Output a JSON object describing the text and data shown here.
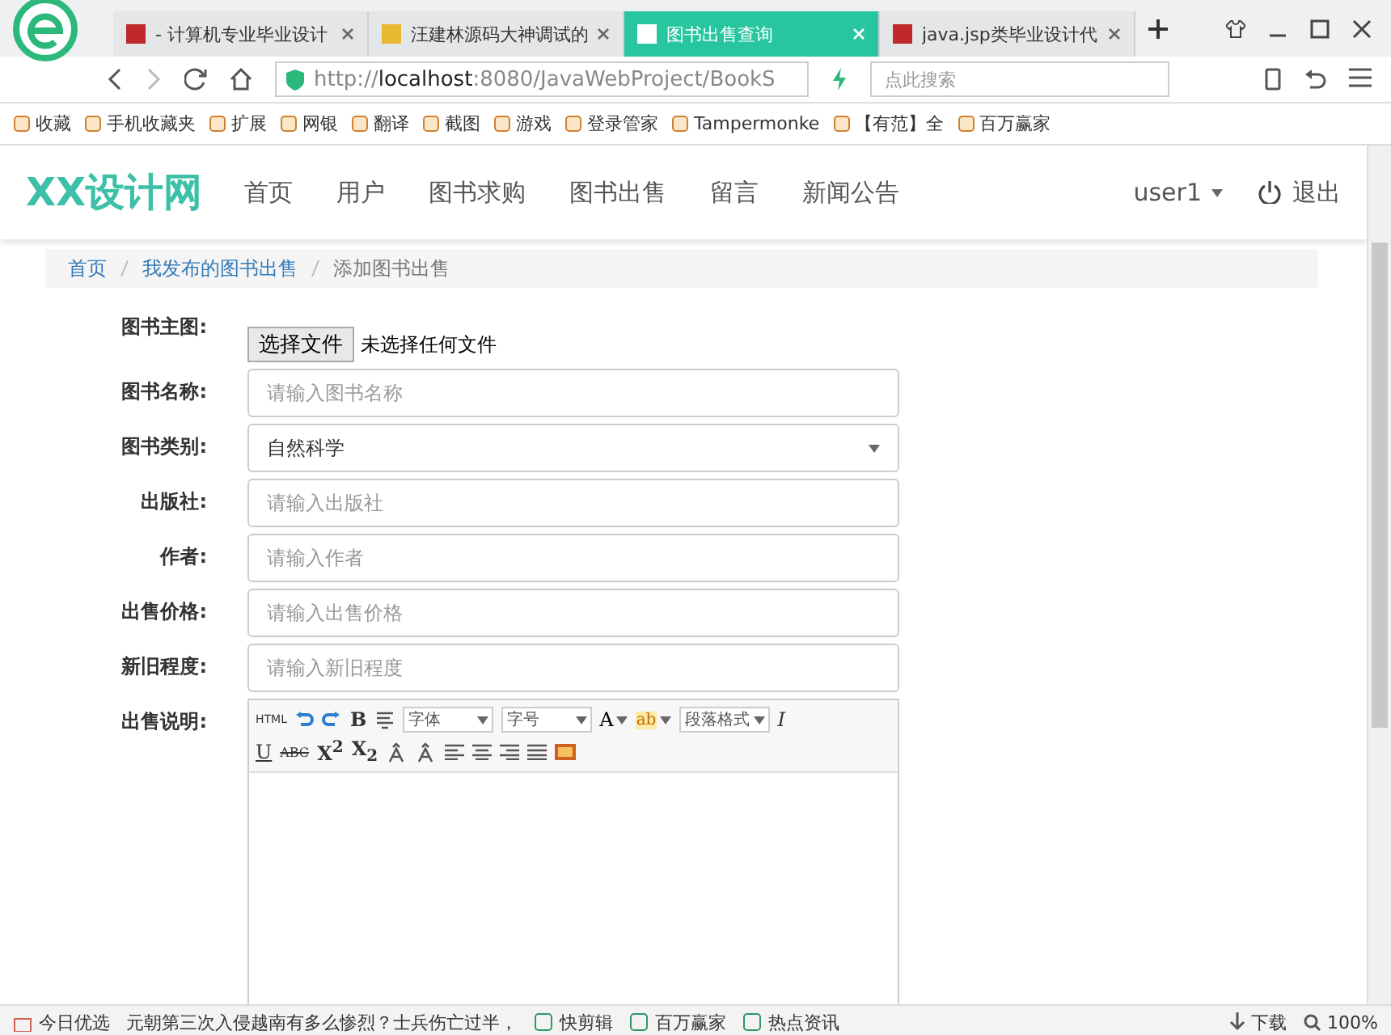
{
  "browser": {
    "tabs": [
      {
        "title": "- 计算机专业毕业设计",
        "selected": false,
        "color": "#c0282d"
      },
      {
        "title": "汪建林源码大神调试的",
        "selected": false,
        "color": "#e8b830"
      },
      {
        "title": "图书出售查询",
        "selected": true,
        "color": "#ffffff"
      },
      {
        "title": "java.jsp类毕业设计代",
        "selected": false,
        "color": "#c0282d"
      }
    ],
    "url": "http://**localhost**:8080/JavaWebProject/BookS",
    "search_placeholder": "点此搜索",
    "bookmarks": [
      {
        "label": "收藏"
      },
      {
        "label": "手机收藏夹"
      },
      {
        "label": "扩展"
      },
      {
        "label": "网银"
      },
      {
        "label": "翻译"
      },
      {
        "label": "截图"
      },
      {
        "label": "游戏"
      },
      {
        "label": "登录管家"
      },
      {
        "label": "Tampermonke"
      },
      {
        "label": "【有范】全"
      },
      {
        "label": "百万赢家"
      }
    ]
  },
  "site": {
    "logo": "XX设计网",
    "nav": [
      "首页",
      "用户",
      "图书求购",
      "图书出售",
      "留言",
      "新闻公告"
    ],
    "user": "user1",
    "logout": "退出"
  },
  "breadcrumb": [
    "首页",
    "我发布的图书出售",
    "添加图书出售"
  ],
  "form": [
    {
      "kind": "file",
      "label": "图书主图:",
      "button": "选择文件",
      "status": "未选择任何文件"
    },
    {
      "kind": "input",
      "label": "图书名称:",
      "placeholder": "请输入图书名称"
    },
    {
      "kind": "select",
      "label": "图书类别:",
      "value": "自然科学"
    },
    {
      "kind": "input",
      "label": "出版社:",
      "placeholder": "请输入出版社"
    },
    {
      "kind": "input",
      "label": "作者:",
      "placeholder": "请输入作者"
    },
    {
      "kind": "input",
      "label": "出售价格:",
      "placeholder": "请输入出售价格"
    },
    {
      "kind": "input",
      "label": "新旧程度:",
      "placeholder": "请输入新旧程度"
    },
    {
      "kind": "editor",
      "label": "出售说明:"
    }
  ],
  "editor_toolbar": [
    [
      {
        "kind": "tiny",
        "label": "HTML"
      },
      {
        "kind": "undo"
      },
      {
        "kind": "redo"
      },
      {
        "kind": "bold",
        "label": "B"
      },
      {
        "kind": "clear"
      },
      {
        "kind": "select",
        "label": "字体"
      },
      {
        "kind": "select",
        "label": "字号"
      },
      {
        "kind": "dropdown",
        "label": "A"
      },
      {
        "kind": "highlight",
        "label": "ab"
      },
      {
        "kind": "select",
        "label": "段落格式"
      },
      {
        "kind": "italic",
        "label": "I"
      }
    ],
    [
      {
        "kind": "underline",
        "label": "U"
      },
      {
        "kind": "strike",
        "label": "ABC"
      },
      {
        "kind": "bold",
        "label": "X$^{2}$"
      },
      {
        "kind": "bold",
        "label": "X$_{2}$"
      },
      {
        "kind": "accent"
      },
      {
        "kind": "accent"
      },
      {
        "kind": "alignleft"
      },
      {
        "kind": "aligncenter"
      },
      {
        "kind": "alignright"
      },
      {
        "kind": "justify"
      },
      {
        "kind": "image"
      }
    ]
  ],
  "status_bar": {
    "left": "今日优选",
    "news": "元朝第三次入侵越南有多么惨烈？士兵伤亡过半，",
    "items": [
      "快剪辑",
      "百万赢家",
      "热点资讯"
    ],
    "download": "下载",
    "zoom": "100%"
  }
}
